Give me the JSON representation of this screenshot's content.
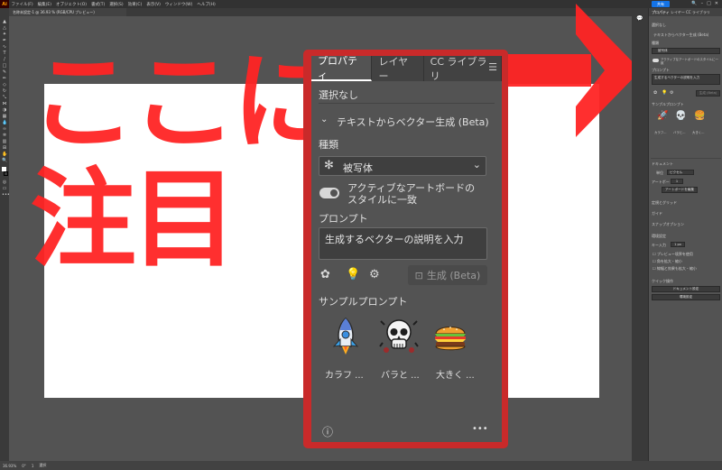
{
  "app": {
    "logo": "Ai",
    "menu": [
      "ファイル(F)",
      "編集(E)",
      "オブジェクト(O)",
      "書式(T)",
      "選択(S)",
      "効果(C)",
      "表示(V)",
      "ウィンドウ(W)",
      "ヘルプ(H)"
    ],
    "share_label": "共有",
    "document_tab": "名称未設定-1 @ 36.93 % (RGB/CPU プレビュー)"
  },
  "annotation": {
    "line1": "ここに",
    "line2": "注目",
    "color": "#ff2424"
  },
  "status_bar": {
    "zoom": "36.93%",
    "rotation": "0°",
    "artboard": "1",
    "tool": "選択"
  },
  "properties_panel": {
    "tabs": [
      {
        "label": "プロパティ",
        "active": true
      },
      {
        "label": "レイヤー",
        "active": false
      },
      {
        "label": "CC ライブラリ",
        "active": false
      }
    ],
    "selection_state": "選択なし",
    "section_title": "テキストからベクター生成 (Beta)",
    "type_label": "種類",
    "type_value": "被写体",
    "toggle_label_line1": "アクティブなアートボードの",
    "toggle_label_line2": "スタイルに一致",
    "prompt_label": "プロンプト",
    "prompt_placeholder": "生成するベクターの説明を入力",
    "generate_label": "生成 (Beta)",
    "samples_label": "サンプルプロンプト",
    "samples": [
      {
        "label": "カラフ ...",
        "icon": "rocket-icon"
      },
      {
        "label": "バラと ...",
        "icon": "skull-icon"
      },
      {
        "label": "大きく ...",
        "icon": "burger-icon"
      }
    ],
    "info_icon": "ⓘ",
    "more_icon": "•••"
  },
  "mini_panel": {
    "tabs": [
      "プロパティ",
      "レイヤー",
      "CC ライブラリ"
    ],
    "selection_state": "選択なし",
    "section_title": "テキストからベクター生成 (Beta)",
    "type_label": "種類",
    "type_value": "被写体",
    "toggle_label": "アクティブなアートボードのスタイルに一致",
    "prompt_label": "プロンプト",
    "prompt_placeholder": "生成するベクターの説明を入力",
    "generate_label": "生成 (Beta)",
    "samples_label": "サンプルプロンプト",
    "sample_labels": [
      "カラフ...",
      "バラと...",
      "大きく..."
    ],
    "document_label": "ドキュメント",
    "units_label": "単位",
    "units_value": "ピクセル",
    "artboard_label": "アートボード",
    "artboard_value": "1",
    "edit_artboard_label": "アートボードを編集",
    "ruler_grid_label": "定規とグリッド",
    "guides_label": "ガイド",
    "snap_label": "スナップオプション",
    "prefs_label": "環境設定",
    "key_increment_label": "キー入力",
    "key_increment_value": "1 px",
    "preview_bounds_label": "プレビュー境界を使用",
    "corner_scale_label": "角を拡大・縮小",
    "stroke_scale_label": "線幅と効果も拡大・縮小",
    "quick_actions_label": "クイック操作",
    "document_setup_label": "ドキュメント設定",
    "preferences_label": "環境設定"
  }
}
